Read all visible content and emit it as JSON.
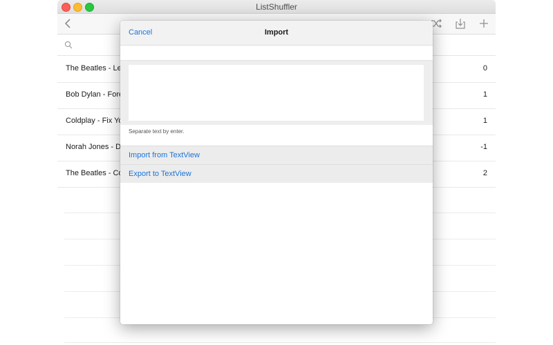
{
  "window": {
    "title": "ListShuffler"
  },
  "list": {
    "rows": [
      {
        "name": "The Beatles - Le",
        "count": "0"
      },
      {
        "name": "Bob Dylan - Fore",
        "count": "1"
      },
      {
        "name": "Coldplay - Fix Yo",
        "count": "1"
      },
      {
        "name": "Norah Jones - D",
        "count": "-1"
      },
      {
        "name": "The Beatles - Co",
        "count": "2"
      }
    ]
  },
  "modal": {
    "cancel_label": "Cancel",
    "title": "Import",
    "textview_value": "",
    "hint": "Separate text by enter.",
    "import_label": "Import from TextView",
    "export_label": "Export to TextView"
  },
  "colors": {
    "accent": "#1a73d9"
  },
  "icons": [
    "back-icon",
    "shuffle-icon",
    "share-icon",
    "add-icon",
    "search-icon"
  ]
}
